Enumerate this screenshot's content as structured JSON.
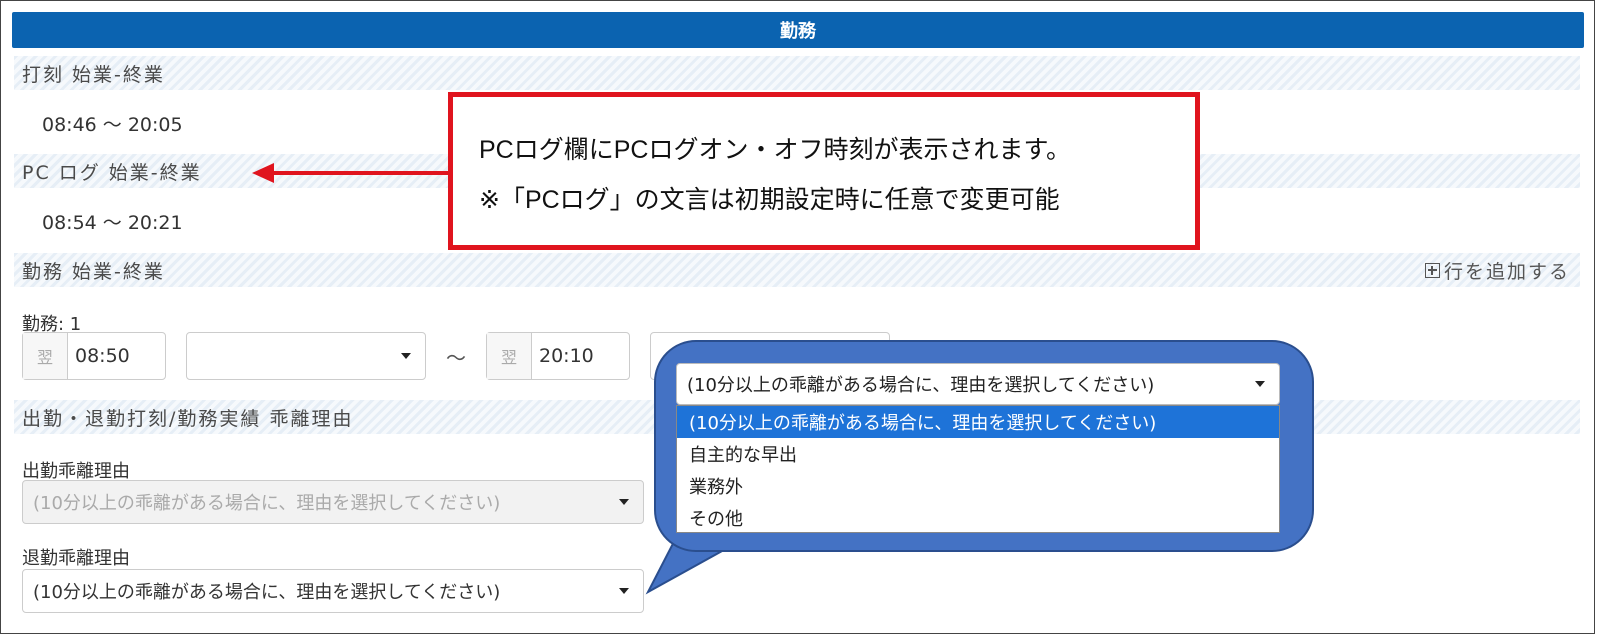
{
  "header": {
    "title": "勤務"
  },
  "sections": {
    "stamp": {
      "title": "打刻 始業-終業",
      "value": "08:46 ～ 20:05"
    },
    "pclog": {
      "title": "PC ログ 始業-終業",
      "value": "08:54 ～ 20:21"
    },
    "work": {
      "title": "勤務 始業-終業",
      "add_label": "行を追加する"
    },
    "deviation": {
      "title": "出勤・退勤打刻/勤務実績 乖離理由"
    }
  },
  "work_entry": {
    "label": "勤務: 1",
    "start_prefix": "翌",
    "start_time": "08:50",
    "start_select": "",
    "tilde": "～",
    "end_prefix": "翌",
    "end_time": "20:10"
  },
  "deviation_fields": {
    "start_label": "出勤乖離理由",
    "start_value": "(10分以上の乖離がある場合に、理由を選択してください)",
    "end_label": "退勤乖離理由",
    "end_value": "(10分以上の乖離がある場合に、理由を選択してください)"
  },
  "callout": {
    "line1": "PCログ欄にPCログオン・オフ時刻が表示されます。",
    "line2": "※「PCログ」の文言は初期設定時に任意で変更可能"
  },
  "dropdown": {
    "current": "(10分以上の乖離がある場合に、理由を選択してください)",
    "options": [
      "(10分以上の乖離がある場合に、理由を選択してください)",
      "自主的な早出",
      "業務外",
      "その他"
    ]
  },
  "colors": {
    "header_bg": "#0b63b0",
    "callout_border": "#e0141e",
    "bubble": "#4472c4",
    "option_selected": "#1e73d8"
  }
}
